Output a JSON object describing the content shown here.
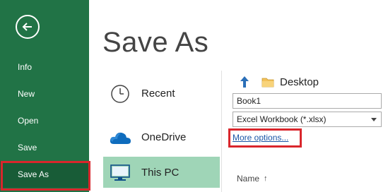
{
  "sidebar": {
    "back_icon": "back-arrow-circle-icon",
    "items": [
      {
        "label": "Info"
      },
      {
        "label": "New"
      },
      {
        "label": "Open"
      },
      {
        "label": "Save"
      },
      {
        "label": "Save As"
      }
    ],
    "active_item": "Save As",
    "color": "#217346",
    "active_color": "#185c37"
  },
  "main": {
    "title": "Save As",
    "places": [
      {
        "label": "Recent",
        "icon": "clock-icon"
      },
      {
        "label": "OneDrive",
        "icon": "cloud-icon"
      },
      {
        "label": "This PC",
        "icon": "computer-icon",
        "selected": true
      }
    ],
    "location": {
      "up_icon": "up-arrow-icon",
      "folder_icon": "folder-icon",
      "path": "Desktop"
    },
    "file_name": "Book1",
    "file_type": "Excel Workbook (*.xlsx)",
    "more_options": "More options...",
    "column_header": "Name",
    "sort_indicator": "↑"
  },
  "highlight_color": "#d9262c"
}
